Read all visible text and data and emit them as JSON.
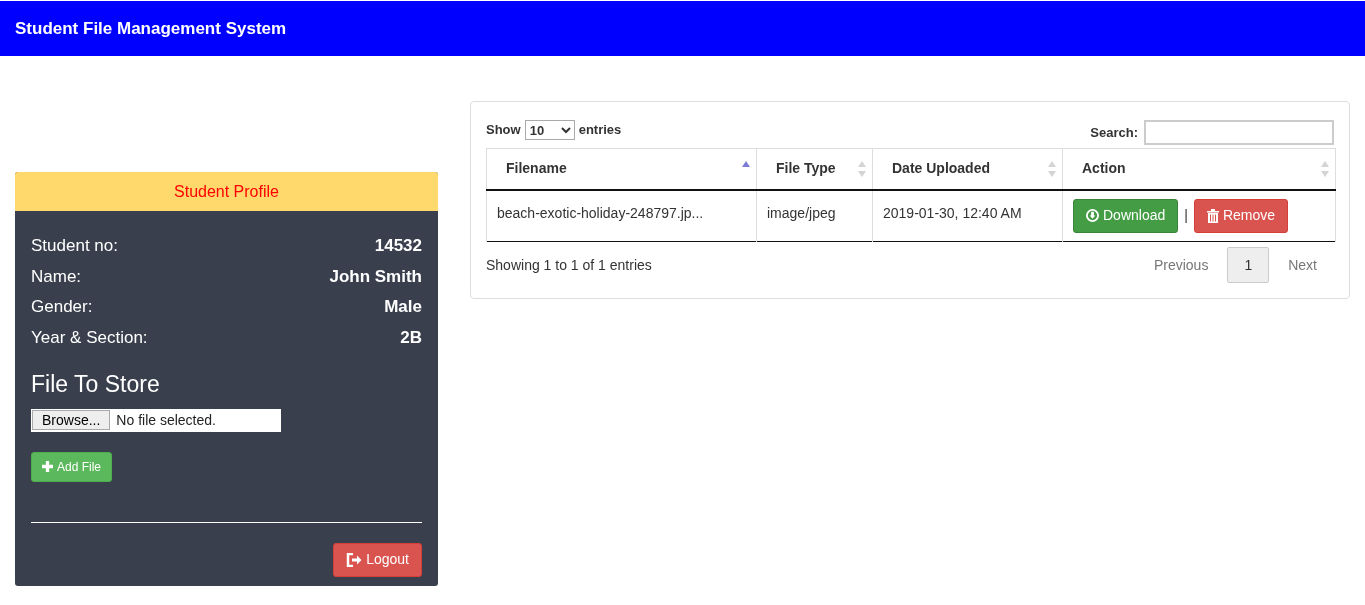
{
  "navbar": {
    "title": "Student File Management System"
  },
  "profile": {
    "header": "Student Profile",
    "fields": [
      {
        "label": "Student no:",
        "value": "14532"
      },
      {
        "label": "Name:",
        "value": "John Smith"
      },
      {
        "label": "Gender:",
        "value": "Male"
      },
      {
        "label": "Year & Section:",
        "value": "2B"
      }
    ],
    "upload_heading": "File To Store",
    "file_input": {
      "button": "Browse...",
      "status": "No file selected."
    },
    "add_button": "Add File",
    "logout_button": "Logout"
  },
  "table": {
    "length_label_before": "Show",
    "length_value": "10",
    "length_label_after": "entries",
    "search_label": "Search:",
    "columns": [
      {
        "label": "Filename",
        "sorted": true
      },
      {
        "label": "File Type",
        "sorted": false
      },
      {
        "label": "Date Uploaded",
        "sorted": false
      },
      {
        "label": "Action",
        "sorted": false
      }
    ],
    "rows": [
      {
        "filename": "beach-exotic-holiday-248797.jp...",
        "file_type": "image/jpeg",
        "date": "2019-01-30, 12:40 AM",
        "actions": [
          {
            "kind": "download",
            "label": "Download"
          },
          {
            "kind": "remove",
            "label": "Remove"
          }
        ],
        "separator": "|"
      }
    ],
    "info": "Showing 1 to 1 of 1 entries",
    "pagination": [
      {
        "label": "Previous",
        "disabled": true,
        "selected": false
      },
      {
        "label": "1",
        "disabled": false,
        "selected": true
      },
      {
        "label": "Next",
        "disabled": true,
        "selected": false
      }
    ]
  }
}
